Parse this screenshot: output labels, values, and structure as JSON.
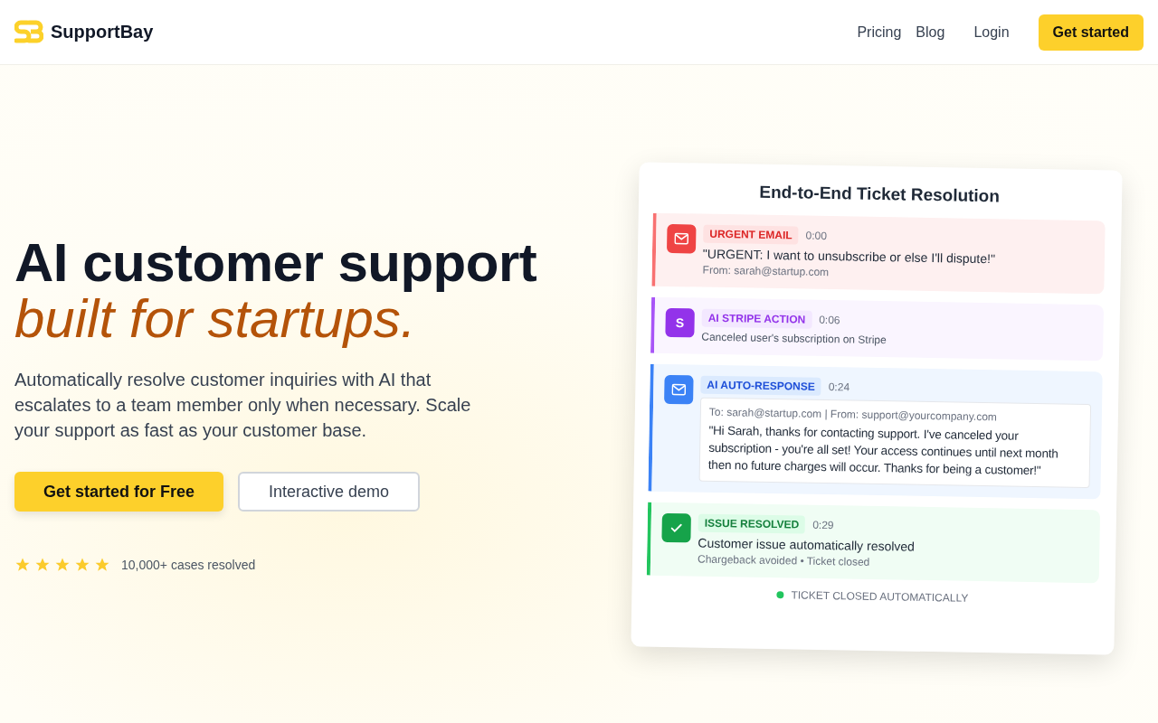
{
  "brand": {
    "name": "SupportBay"
  },
  "nav": {
    "links": [
      "Pricing",
      "Blog"
    ],
    "login": "Login",
    "cta": "Get started"
  },
  "hero": {
    "title": "AI customer support",
    "subtitle": "built for startups.",
    "description": "Automatically resolve customer inquiries with AI that escalates to a team member only when necessary. Scale your support as fast as your customer base.",
    "primary_button": "Get started for Free",
    "secondary_button": "Interactive demo",
    "stars": 5,
    "rating_text": "10,000+ cases resolved"
  },
  "card": {
    "title": "End-to-End Ticket Resolution",
    "events": [
      {
        "kind": "email",
        "tag": "URGENT EMAIL",
        "time": "0:00",
        "text": "\"URGENT: I want to unsubscribe or else I'll dispute!\"",
        "meta": "From: sarah@startup.com"
      },
      {
        "kind": "action",
        "icon_text": "S",
        "tag": "AI STRIPE ACTION",
        "time": "0:06",
        "text": "Canceled user's subscription on Stripe"
      },
      {
        "kind": "response",
        "tag": "AI AUTO-RESPONSE",
        "time": "0:24",
        "header": "To: sarah@startup.com | From: support@yourcompany.com",
        "text": "\"Hi Sarah, thanks for contacting support. I've canceled your subscription - you're all set! Your access continues until next month then no future charges will occur. Thanks for being a customer!\""
      },
      {
        "kind": "resolved",
        "tag": "ISSUE RESOLVED",
        "time": "0:29",
        "text": "Customer issue automatically resolved",
        "meta": "Chargeback avoided • Ticket closed"
      }
    ],
    "footer": "TICKET CLOSED AUTOMATICALLY"
  }
}
